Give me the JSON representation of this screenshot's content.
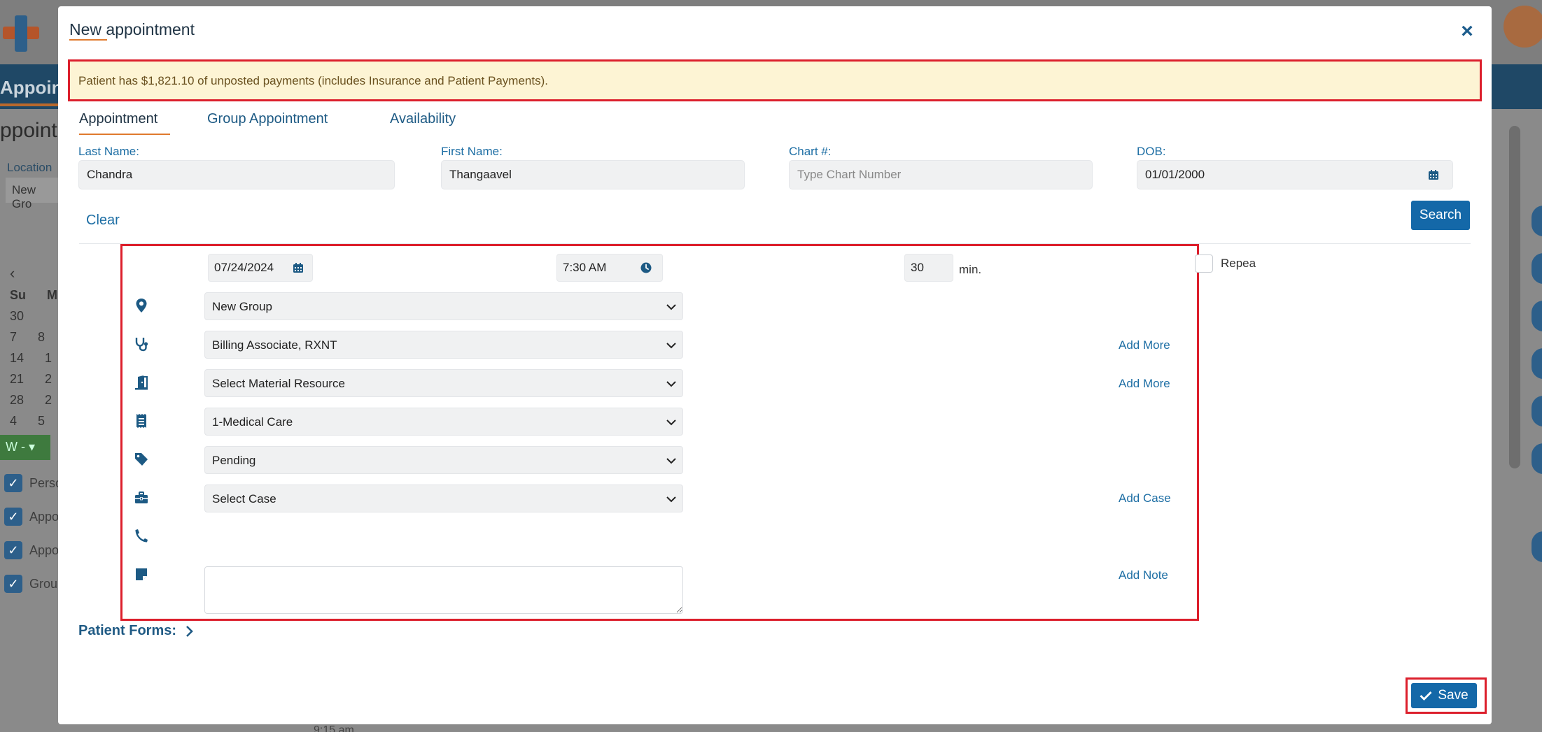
{
  "background": {
    "nav_text": "Appoin",
    "page_title": "ppoint",
    "location_label": "Location",
    "location_value": "New Gro",
    "calendar_header": [
      "Su",
      "M"
    ],
    "calendar_rows": [
      [
        "30",
        ""
      ],
      [
        "7",
        "8"
      ],
      [
        "14",
        "1"
      ],
      [
        "21",
        "2"
      ],
      [
        "28",
        "2"
      ],
      [
        "4",
        "5"
      ]
    ],
    "week_button": "W -",
    "checklist": [
      "Perso",
      "Appo",
      "Appo",
      "Grou"
    ],
    "time_label": "9:15 am"
  },
  "modal": {
    "title": "New appointment",
    "close_label": "×",
    "alert_text": "Patient has $1,821.10 of unposted payments (includes Insurance and Patient Payments).",
    "tabs": [
      "Appointment",
      "Group Appointment",
      "Availability"
    ],
    "patient": {
      "last_name_label": "Last Name:",
      "last_name_value": "Chandra",
      "first_name_label": "First Name:",
      "first_name_value": "Thangaavel",
      "chart_label": "Chart #:",
      "chart_placeholder": "Type Chart Number",
      "dob_label": "DOB:",
      "dob_value": "01/01/2000"
    },
    "clear_label": "Clear",
    "search_label": "Search",
    "appointment": {
      "date": "07/24/2024",
      "time": "7:30 AM",
      "duration": "30",
      "duration_unit": "min.",
      "repeat_label": "Repeat",
      "location": "New Group",
      "provider": "Billing Associate, RXNT",
      "material_resource": "Select Material Resource",
      "visit_type": "1-Medical Care",
      "status": "Pending",
      "case": "Select Case",
      "add_more_provider": "Add More",
      "add_more_resource": "Add More",
      "add_case": "Add Case",
      "add_note": "Add Note"
    },
    "patient_forms_label": "Patient Forms:",
    "save_label": "Save"
  },
  "colors": {
    "accent": "#1468a8",
    "highlight_border": "#dc1f2c",
    "alert_bg": "#fdf4d4",
    "tab_underline": "#e07a2e"
  }
}
